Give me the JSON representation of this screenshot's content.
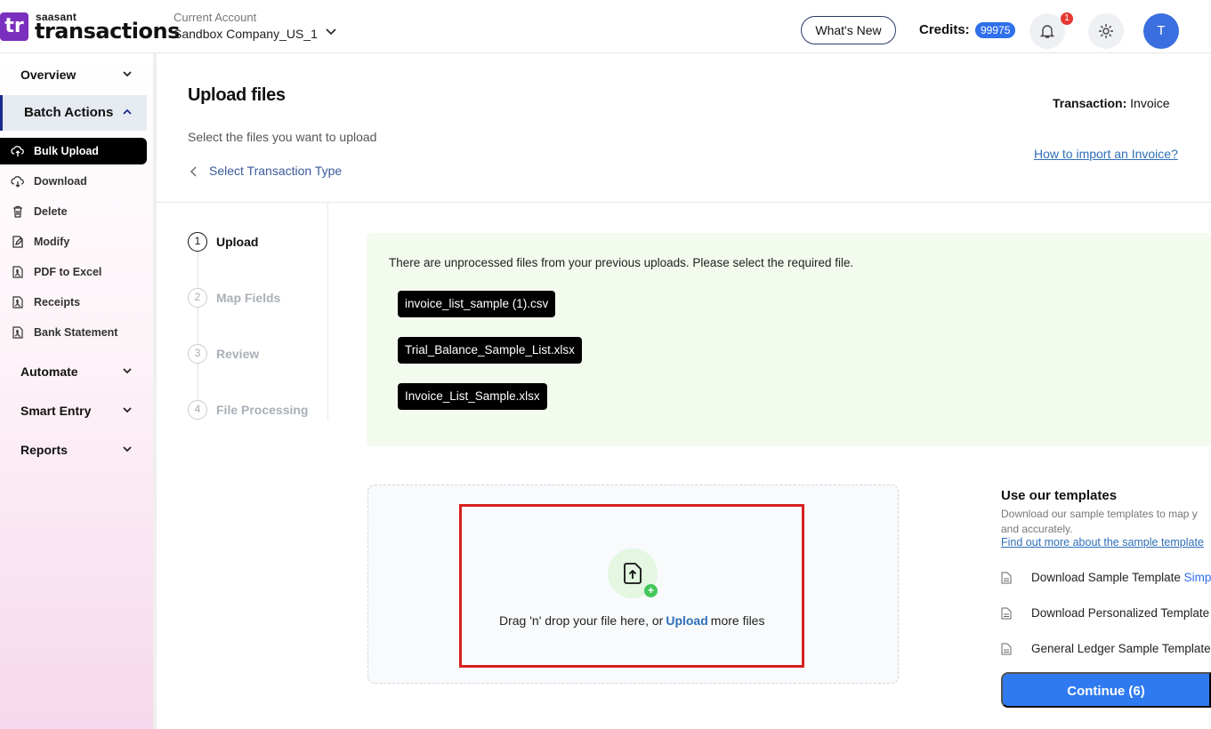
{
  "brand": {
    "badge": "tr",
    "small": "saasant",
    "name": "transactions"
  },
  "account": {
    "label": "Current Account",
    "name": "Sandbox Company_US_1"
  },
  "header": {
    "whats_new": "What's New",
    "credits_label": "Credits:",
    "credits_value": "99975",
    "notification_count": "1",
    "avatar_initial": "T"
  },
  "sidebar": {
    "overview": "Overview",
    "batch_actions": "Batch Actions",
    "items": [
      {
        "label": "Bulk Upload",
        "icon": "cloud-upload-icon"
      },
      {
        "label": "Download",
        "icon": "cloud-download-icon"
      },
      {
        "label": "Delete",
        "icon": "trash-icon"
      },
      {
        "label": "Modify",
        "icon": "edit-icon"
      },
      {
        "label": "PDF to Excel",
        "icon": "pdf-icon"
      },
      {
        "label": "Receipts",
        "icon": "receipt-icon"
      },
      {
        "label": "Bank Statement",
        "icon": "statement-icon"
      }
    ],
    "automate": "Automate",
    "smart_entry": "Smart Entry",
    "reports": "Reports"
  },
  "main": {
    "title": "Upload files",
    "subtitle": "Select the files you want to upload",
    "back_link": "Select Transaction Type",
    "transaction_label": "Transaction:",
    "transaction_value": "Invoice",
    "howto_link": "How to import an Invoice?"
  },
  "steps": [
    {
      "num": "1",
      "label": "Upload"
    },
    {
      "num": "2",
      "label": "Map Fields"
    },
    {
      "num": "3",
      "label": "Review"
    },
    {
      "num": "4",
      "label": "File Processing"
    }
  ],
  "unprocessed": {
    "message": "There are unprocessed files from your previous uploads. Please select the required file.",
    "files": [
      "invoice_list_sample (1).csv",
      "Trial_Balance_Sample_List.xlsx",
      "Invoice_List_Sample.xlsx"
    ]
  },
  "dropzone": {
    "text_before": "Drag 'n' drop your file here, or",
    "upload_link": "Upload",
    "text_after": "more files"
  },
  "templates": {
    "title": "Use our templates",
    "desc_line1": "Download our sample templates to map y",
    "desc_line2": "and accurately.",
    "link": "Find out more about the sample template",
    "rows": [
      {
        "label": "Download Sample Template",
        "accent": "Simpl"
      },
      {
        "label": "Download Personalized Template",
        "accent": "("
      },
      {
        "label": "General Ledger Sample Template",
        "accent": "("
      }
    ],
    "continue": "Continue (6)"
  },
  "colors": {
    "brand": "#7b2fbe",
    "primary": "#2f7af0",
    "highlight": "#d81f1f",
    "panel": "#f3fbee"
  }
}
